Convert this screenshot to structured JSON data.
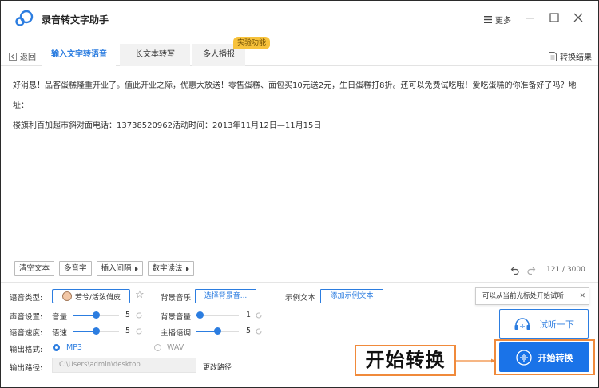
{
  "app": {
    "title": "录音转文字助手",
    "more_label": "更多",
    "colors": {
      "accent": "#2c7de0",
      "primary_button": "#1a73e8",
      "highlight_border": "#f08a3b",
      "badge": "#f7c23b"
    }
  },
  "tabbar": {
    "back_label": "返回",
    "tabs": [
      {
        "label": "输入文字转语音",
        "active": true
      },
      {
        "label": "长文本转写",
        "active": false
      },
      {
        "label": "多人播报",
        "active": false
      }
    ],
    "experimental_badge": "实验功能",
    "convert_result_label": "转换结果"
  },
  "editor": {
    "line1": "好消息！品客蛋糕隆重开业了。值此开业之际，优惠大放送！零售蛋糕、面包买10元送2元，生日蛋糕打8折。还可以免费试吃哦！爱吃蛋糕的你准备好了吗？地址：",
    "line2": "楼旗利百加超市斜对面电话：13738520962活动时间：2013年11月12日—11月15日",
    "toolbar": {
      "clear": "清空文本",
      "polyphone": "多音字",
      "insert_pause": "插入间隔",
      "number_reading": "数字读法"
    },
    "counter": "121 / 3000"
  },
  "settings": {
    "voice_type_label": "语音类型:",
    "voice_name": "若兮/活泼俏皮",
    "bg_music_label": "背景音乐",
    "bg_music_button": "选择背景音...",
    "sample_text_label": "示例文本",
    "sample_text_button": "添加示例文本",
    "sound_settings_label": "声音设置:",
    "volume_label": "音量",
    "volume_value": "5",
    "volume_level": 0.5,
    "bg_volume_label": "背景音量",
    "bg_volume_value": "1",
    "bg_volume_level": 0.1,
    "speed_label": "语音速度:",
    "rate_label": "语速",
    "rate_value": "5",
    "rate_level": 0.5,
    "pitch_label": "主播语调",
    "pitch_value": "5",
    "pitch_level": 0.5,
    "format_label": "输出格式:",
    "format_mp3": "MP3",
    "format_wav": "WAV",
    "format_selected": "MP3",
    "path_label": "输出路径:",
    "path_value": "C:\\Users\\admin\\desktop",
    "change_path": "更改路径"
  },
  "actions": {
    "tip": "可以从当前光标处开始试听",
    "listen_button": "试听一下",
    "start_button": "开始转换",
    "callout_label": "开始转换"
  }
}
